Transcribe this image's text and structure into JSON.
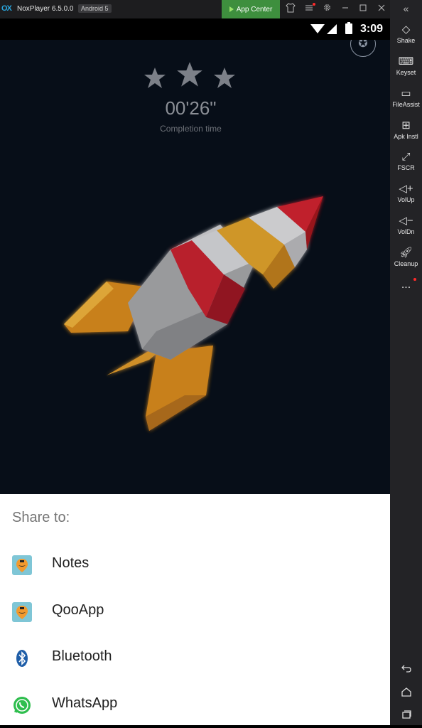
{
  "window": {
    "logo": "OX",
    "title": "NoxPlayer 6.5.0.0",
    "android_badge": "Android 5",
    "app_center": "App Center",
    "icons": [
      "shirt-icon",
      "menu-icon",
      "gear-icon",
      "minimize-icon",
      "maximize-icon",
      "close-icon"
    ]
  },
  "status_bar": {
    "time": "3:09",
    "icons": [
      "wifi-icon",
      "signal-icon",
      "battery-icon"
    ]
  },
  "game": {
    "stars": 3,
    "completion_time": "00'26\"",
    "completion_label": "Completion time",
    "achievement_icon": "achievement-icon"
  },
  "share": {
    "title": "Share to:",
    "items": [
      {
        "label": "Notes",
        "icon": "qooapp-icon"
      },
      {
        "label": "QooApp",
        "icon": "qooapp-icon"
      },
      {
        "label": "Bluetooth",
        "icon": "bluetooth-icon"
      },
      {
        "label": "WhatsApp",
        "icon": "whatsapp-icon"
      }
    ]
  },
  "sidebar": {
    "collapse": "«",
    "tools": [
      {
        "label": "Shake",
        "icon": "shake-icon"
      },
      {
        "label": "Keyset",
        "icon": "keyboard-icon"
      },
      {
        "label": "FileAssist",
        "icon": "monitor-icon"
      },
      {
        "label": "Apk Instl",
        "icon": "apk-install-icon"
      },
      {
        "label": "FSCR",
        "icon": "fullscreen-icon"
      },
      {
        "label": "VolUp",
        "icon": "volume-up-icon"
      },
      {
        "label": "VolDn",
        "icon": "volume-down-icon"
      },
      {
        "label": "Cleanup",
        "icon": "rocket-icon"
      }
    ],
    "more": "...",
    "nav": [
      "back-icon",
      "home-icon",
      "recents-icon"
    ]
  },
  "colors": {
    "app_center_bg": "#3e8f3e",
    "game_bg": "#070e18",
    "rocket_red": "#c8202e",
    "rocket_orange": "#e08a1e",
    "notification_dot": "#ff2a2a"
  }
}
